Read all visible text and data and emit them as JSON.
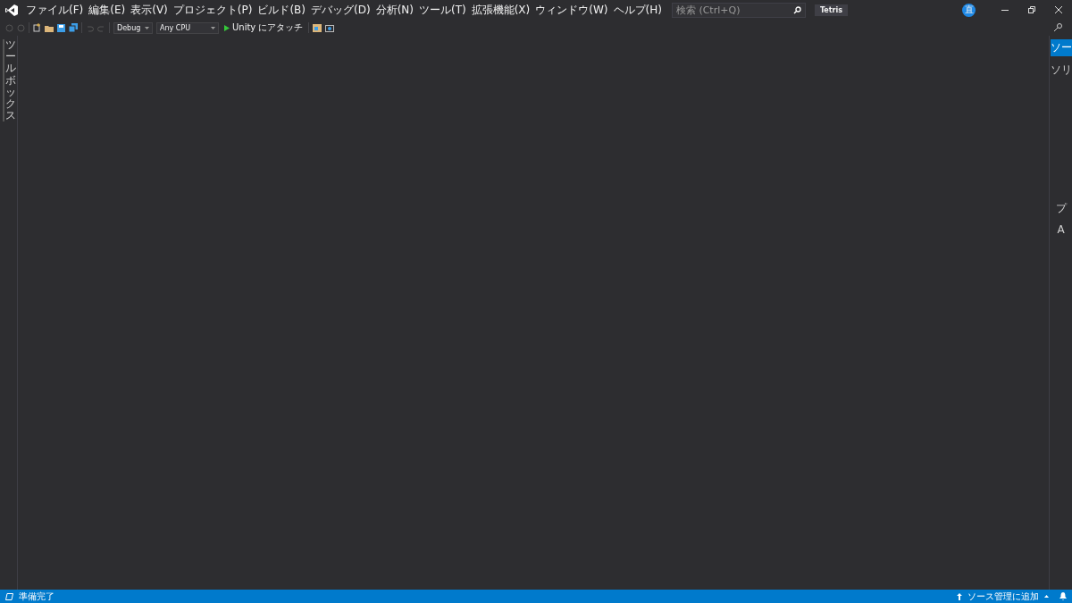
{
  "menu": [
    "ファイル(F)",
    "編集(E)",
    "表示(V)",
    "プロジェクト(P)",
    "ビルド(B)",
    "デバッグ(D)",
    "分析(N)",
    "ツール(T)",
    "拡張機能(X)",
    "ウィンドウ(W)",
    "ヘルプ(H)"
  ],
  "search": {
    "placeholder": "検索 (Ctrl+Q)"
  },
  "solution_name": "Tetris",
  "avatar": "直",
  "toolbar": {
    "configuration": "Debug",
    "platform": "Any CPU",
    "run_target": "Unity にアタッチ"
  },
  "left_tabs": [
    {
      "label": "ツールボックス"
    }
  ],
  "right_tabs": [
    {
      "label": "ソー",
      "selected": true
    },
    {
      "label": "ソリ",
      "selected": false
    },
    {
      "label": "プ",
      "selected": false
    },
    {
      "label": "A",
      "selected": false
    }
  ],
  "status_bar": {
    "message": "準備完了",
    "source_control": "ソース管理に追加"
  }
}
